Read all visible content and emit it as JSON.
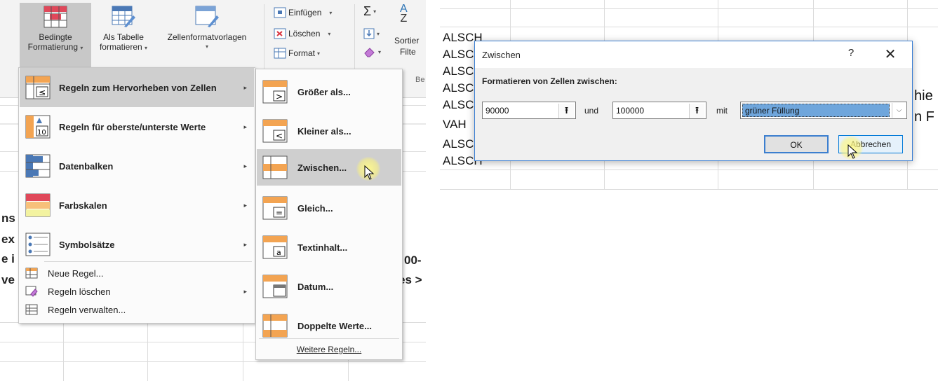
{
  "ribbon": {
    "conditional_formatting": {
      "line1": "Bedingte",
      "line2": "Formatierung",
      "caret": "▾"
    },
    "format_as_table": {
      "line1": "Als Tabelle",
      "line2": "formatieren",
      "caret": "▾"
    },
    "cell_styles": {
      "label": "Zellenformatvorlagen",
      "caret": "▾"
    },
    "insert": {
      "label": "Einfügen",
      "caret": "▾"
    },
    "delete": {
      "label": "Löschen",
      "caret": "▾"
    },
    "format": {
      "label": "Format",
      "caret": "▾"
    },
    "sum_glyph": "Σ",
    "sort": {
      "line1": "Sortier",
      "line2": "Filte"
    },
    "sort_letters": {
      "a": "A",
      "z": "Z"
    },
    "group_frag": "Be"
  },
  "sheet_fragments": [
    "ns",
    "ex",
    "e i",
    "ve",
    "00-",
    "es >"
  ],
  "main_menu": {
    "items": [
      {
        "label": "Regeln zum Hervorheben von Zellen",
        "underline": "H"
      },
      {
        "label": "Regeln für oberste/unterste Werte"
      },
      {
        "label": "Datenbalken"
      },
      {
        "label": "Farbskalen"
      },
      {
        "label": "Symbolsätze"
      }
    ],
    "small_items": [
      {
        "label": "Neue Regel..."
      },
      {
        "label": "Regeln löschen"
      },
      {
        "label": "Regeln verwalten..."
      }
    ],
    "arrow": "▸"
  },
  "sub_menu": {
    "items": [
      {
        "label": "Größer als..."
      },
      {
        "label": "Kleiner als..."
      },
      {
        "label": "Zwischen..."
      },
      {
        "label": "Gleich..."
      },
      {
        "label": "Textinhalt..."
      },
      {
        "label": "Datum..."
      },
      {
        "label": "Doppelte Werte..."
      }
    ],
    "more": "Weitere Regeln..."
  },
  "right_sheet": {
    "cells": [
      "ALSCH",
      "ALSC",
      "ALSC",
      "ALSC",
      "ALSC",
      "VAH",
      "ALSCH",
      "ALSCH"
    ],
    "frag_right_1": "hie",
    "frag_right_2": "n F"
  },
  "dialog": {
    "title": "Zwischen",
    "help": "?",
    "close": "✕",
    "label": "Formatieren von Zellen zwischen:",
    "value_from": "90000",
    "and_label": "und",
    "value_to": "100000",
    "with_label": "mit",
    "format_selected": "grüner Füllung",
    "ok": "OK",
    "cancel": "Abbrechen",
    "ref_glyph": "⭱",
    "select_arrow": "⌵"
  }
}
